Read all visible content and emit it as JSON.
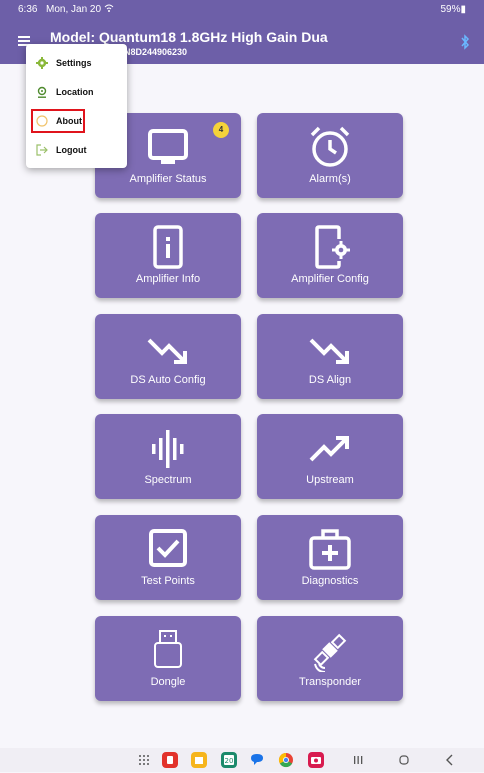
{
  "status": {
    "time": "6:36",
    "date": "Mon, Jan 20",
    "battery": "59%"
  },
  "header": {
    "title": "Model: Quantum18 1.8GHz  High Gain Dua",
    "serial": "N8D244906230"
  },
  "menu": {
    "items": [
      {
        "label": "Settings",
        "icon": "gear-icon"
      },
      {
        "label": "Location",
        "icon": "location-pin-icon"
      },
      {
        "label": "About",
        "icon": "info-icon"
      },
      {
        "label": "Logout",
        "icon": "logout-icon"
      }
    ]
  },
  "tiles": [
    {
      "label": "Amplifier Status",
      "icon": "monitor-icon",
      "badge": "4"
    },
    {
      "label": "Alarm(s)",
      "icon": "alarm-clock-icon"
    },
    {
      "label": "Amplifier Info",
      "icon": "device-info-icon"
    },
    {
      "label": "Amplifier Config",
      "icon": "device-settings-icon"
    },
    {
      "label": "DS Auto Config",
      "icon": "trend-down-icon"
    },
    {
      "label": "DS Align",
      "icon": "trend-down-icon"
    },
    {
      "label": "Spectrum",
      "icon": "waveform-icon"
    },
    {
      "label": "Upstream",
      "icon": "trend-up-icon"
    },
    {
      "label": "Test Points",
      "icon": "checkbox-icon"
    },
    {
      "label": "Diagnostics",
      "icon": "medical-kit-icon"
    },
    {
      "label": "Dongle",
      "icon": "usb-dongle-icon"
    },
    {
      "label": "Transponder",
      "icon": "satellite-icon"
    }
  ],
  "colors": {
    "primary": "#6d5fa8",
    "tile": "#7e6cb4",
    "badge": "#f5d33a",
    "highlight": "#e0141c"
  },
  "navbar": {
    "icons": [
      "apps-grid-icon",
      "app-red-icon",
      "app-files-icon",
      "app-calendar-icon",
      "app-messages-icon",
      "app-chrome-icon",
      "app-camera-icon",
      "recents-icon",
      "home-icon",
      "back-icon"
    ],
    "calendar_day": "20"
  }
}
